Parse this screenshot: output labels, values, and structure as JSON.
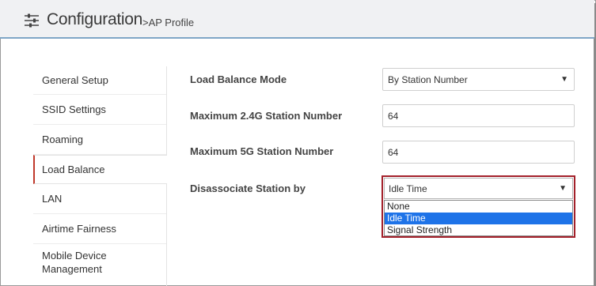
{
  "header": {
    "title": "Configuration",
    "breadcrumb": ">AP Profile",
    "icon": "sliders-icon"
  },
  "sidebar": {
    "items": [
      {
        "label": "General Setup",
        "active": false
      },
      {
        "label": "SSID Settings",
        "active": false
      },
      {
        "label": "Roaming",
        "active": false
      },
      {
        "label": "Load Balance",
        "active": true
      },
      {
        "label": "LAN",
        "active": false
      },
      {
        "label": "Airtime Fairness",
        "active": false
      },
      {
        "label": "Mobile Device Management",
        "active": false
      }
    ]
  },
  "form": {
    "load_balance_mode": {
      "label": "Load Balance Mode",
      "value": "By Station Number"
    },
    "max_24g": {
      "label": "Maximum 2.4G Station Number",
      "value": "64"
    },
    "max_5g": {
      "label": "Maximum 5G Station Number",
      "value": "64"
    },
    "disassociate": {
      "label": "Disassociate Station by",
      "value": "Idle Time",
      "options": [
        "None",
        "Idle Time",
        "Signal Strength"
      ],
      "highlighted": "Idle Time"
    }
  },
  "colors": {
    "accent_red": "#a3202a",
    "header_border": "#7fa6c6",
    "selection_blue": "#1e73e8"
  }
}
